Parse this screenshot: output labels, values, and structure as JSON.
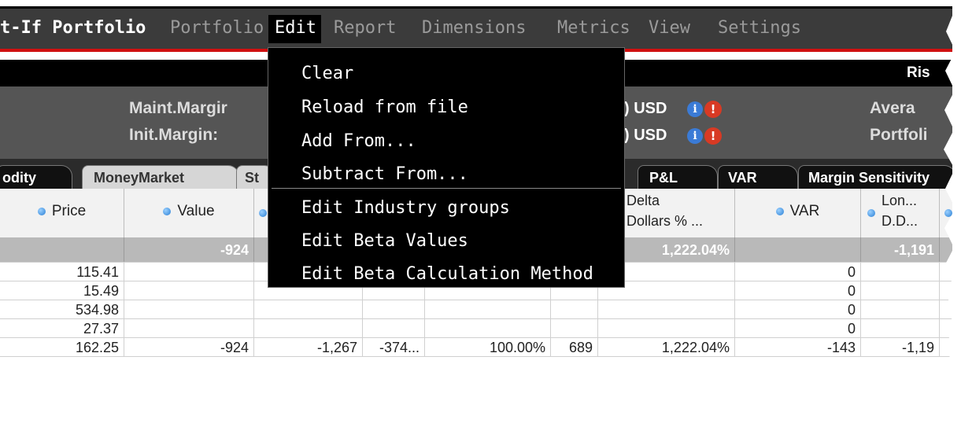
{
  "menubar": {
    "app_title": "t-If Portfolio",
    "items": [
      "Portfolio",
      "Edit",
      "Report",
      "Dimensions",
      "Metrics",
      "View",
      "Settings"
    ]
  },
  "title_strip": {
    "right_text": "Ris"
  },
  "summary": {
    "maint_label": "Maint.Margir",
    "init_label": "Init.Margin:",
    "maint_value": ") USD",
    "init_value": ") USD",
    "right_label_1": "Avera",
    "right_label_2": "Portfoli"
  },
  "tabs": [
    "odity",
    "MoneyMarket",
    "St",
    "P&L",
    "VAR",
    "Margin Sensitivity"
  ],
  "columns": {
    "price": "Price",
    "value": "Value",
    "delta_dollars_line1": "Delta",
    "delta_dollars_line2": "Dollars % ...",
    "var": "VAR",
    "lon_line1": "Lon...",
    "lon_line2": "D.D..."
  },
  "total_row": {
    "value": "-924",
    "delta_pct": "1,222.04%",
    "lon": "-1,191"
  },
  "rows": [
    {
      "price": "115.41",
      "var": "0"
    },
    {
      "price": "15.49",
      "var": "0"
    },
    {
      "price": "534.98",
      "var": "0"
    },
    {
      "price": "27.37",
      "var": "0"
    },
    {
      "price": "162.25",
      "value": "-924",
      "c3": "-1,267",
      "c4": "-374...",
      "c5": "100.00%",
      "c6": "689",
      "delta_pct": "1,222.04%",
      "var": "-143",
      "lon": "-1,19"
    }
  ],
  "edit_menu": {
    "items": [
      "Clear",
      "Reload from file",
      "Add From...",
      "Subtract From...",
      "Edit Industry groups",
      "Edit Beta Values",
      "Edit Beta Calculation Method"
    ]
  },
  "colors": {
    "menubar_bg": "#3b3b3b",
    "accent_red": "#d01010",
    "info_icon": "#3b7bd6",
    "warning_icon": "#d83a24"
  }
}
